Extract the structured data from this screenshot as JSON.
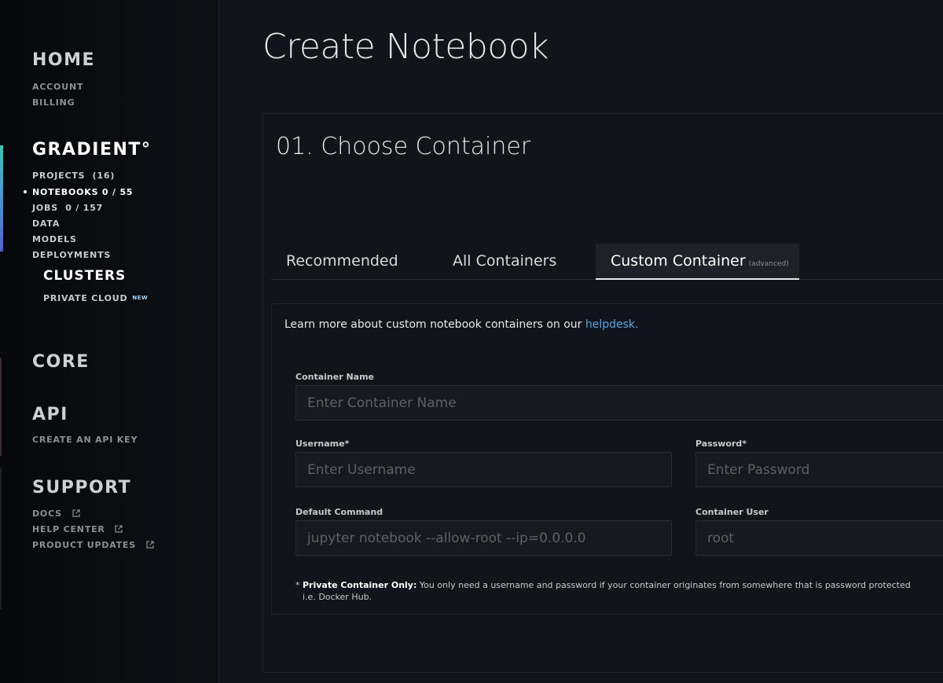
{
  "sidebar": {
    "home": {
      "heading": "HOME",
      "items": [
        "ACCOUNT",
        "BILLING"
      ]
    },
    "gradient": {
      "heading": "GRADIENT°",
      "items": [
        "PROJECTS  (16)",
        "NOTEBOOKS 0 / 55",
        "JOBS  0 / 157",
        "DATA",
        "MODELS",
        "DEPLOYMENTS"
      ],
      "clusters_heading": "CLUSTERS",
      "private_cloud": "PRIVATE CLOUD",
      "new_badge": "NEW"
    },
    "core": {
      "heading": "CORE"
    },
    "api": {
      "heading": "API",
      "items": [
        "CREATE AN API KEY"
      ]
    },
    "support": {
      "heading": "SUPPORT",
      "items": [
        "DOCS",
        "HELP CENTER",
        "PRODUCT UPDATES"
      ]
    },
    "accent_colors": [
      "#39c6b5",
      "#4a8ad8",
      "#5660d0"
    ]
  },
  "main": {
    "title": "Create Notebook",
    "section": {
      "number": "01.",
      "title": "Choose Container"
    },
    "tabs": [
      {
        "label": "Recommended",
        "active": false
      },
      {
        "label": "All Containers",
        "active": false
      },
      {
        "label": "Custom Container",
        "suffix": "(advanced)",
        "active": true
      }
    ],
    "learn_more": {
      "text": "Learn more about custom notebook containers on our ",
      "link": "helpdesk."
    },
    "form": {
      "container_name": {
        "label": "Container Name",
        "placeholder": "Enter Container Name"
      },
      "username": {
        "label": "Username*",
        "placeholder": "Enter Username"
      },
      "password": {
        "label": "Password*",
        "placeholder": "Enter Password"
      },
      "default_command": {
        "label": "Default Command",
        "placeholder": "jupyter notebook --allow-root --ip=0.0.0.0"
      },
      "container_user": {
        "label": "Container User",
        "placeholder": "root"
      }
    },
    "note": {
      "prefix": "* ",
      "bold": "Private Container Only:",
      "text": " You only need a username and password if your container originates from somewhere that is password protected",
      "line2": "i.e. Docker Hub."
    },
    "link_color": "#4fa8e8"
  }
}
